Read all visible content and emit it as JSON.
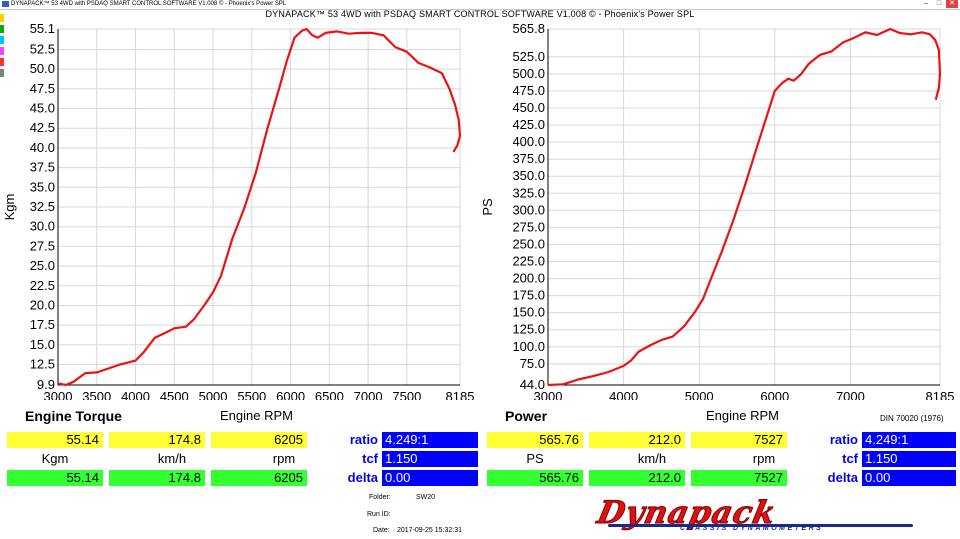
{
  "window": {
    "title": "DYNAPACK™ 53 4WD with PSDAQ SMART CONTROL SOFTWARE V1.008 © - Phoenix's Power SPL",
    "min_label": "–",
    "max_label": "□",
    "close_label": "✕",
    "icon": "app-icon"
  },
  "header": {
    "title": "DYNAPACK™ 53 4WD with PSDAQ SMART CONTROL SOFTWARE V1.008 © - Phoenix's Power SPL"
  },
  "swatch_colors": [
    "#ffd000",
    "#00b000",
    "#00c0ff",
    "#ff40ff",
    "#ff3030",
    "#808080"
  ],
  "chart_data": [
    {
      "type": "line",
      "title": "Engine Torque",
      "xlabel": "Engine RPM",
      "ylabel": "Kgm",
      "xlim": [
        3000,
        8185
      ],
      "ylim": [
        9.9,
        55.1
      ],
      "x_ticks": [
        "3000",
        "3500",
        "4000",
        "4500",
        "5000",
        "5500",
        "6000",
        "6500",
        "7000",
        "7500",
        "8185"
      ],
      "x_tick_values": [
        3000,
        3500,
        4000,
        4500,
        5000,
        5500,
        6000,
        6500,
        7000,
        7500,
        8185
      ],
      "y_ticks": [
        "9.9",
        "12.5",
        "15.0",
        "17.5",
        "20.0",
        "22.5",
        "25.0",
        "27.5",
        "30.0",
        "32.5",
        "35.0",
        "37.5",
        "40.0",
        "42.5",
        "45.0",
        "47.5",
        "50.0",
        "52.5",
        "55.1"
      ],
      "y_tick_values": [
        9.9,
        12.5,
        15,
        17.5,
        20,
        22.5,
        25,
        27.5,
        30,
        32.5,
        35,
        37.5,
        40,
        42.5,
        45,
        47.5,
        50,
        52.5,
        55.1
      ],
      "grid": true,
      "line_color": "#ee1111",
      "points": [
        [
          3000,
          10.1
        ],
        [
          3100,
          9.9
        ],
        [
          3200,
          10.3
        ],
        [
          3350,
          11.4
        ],
        [
          3500,
          11.5
        ],
        [
          3650,
          12.0
        ],
        [
          3800,
          12.5
        ],
        [
          4000,
          13.0
        ],
        [
          4100,
          14.0
        ],
        [
          4250,
          15.9
        ],
        [
          4400,
          16.6
        ],
        [
          4500,
          17.1
        ],
        [
          4650,
          17.3
        ],
        [
          4750,
          18.2
        ],
        [
          4900,
          20.2
        ],
        [
          5000,
          21.7
        ],
        [
          5100,
          23.7
        ],
        [
          5250,
          28.5
        ],
        [
          5400,
          32.3
        ],
        [
          5550,
          36.8
        ],
        [
          5700,
          42.4
        ],
        [
          5850,
          47.5
        ],
        [
          5950,
          51.0
        ],
        [
          6050,
          54.0
        ],
        [
          6150,
          54.9
        ],
        [
          6205,
          55.1
        ],
        [
          6280,
          54.3
        ],
        [
          6350,
          54.0
        ],
        [
          6450,
          54.6
        ],
        [
          6600,
          54.8
        ],
        [
          6750,
          54.5
        ],
        [
          6900,
          54.6
        ],
        [
          7050,
          54.6
        ],
        [
          7200,
          54.3
        ],
        [
          7350,
          52.8
        ],
        [
          7500,
          52.2
        ],
        [
          7650,
          50.8
        ],
        [
          7800,
          50.2
        ],
        [
          7950,
          49.5
        ],
        [
          8050,
          47.5
        ],
        [
          8120,
          45.5
        ],
        [
          8170,
          43.5
        ],
        [
          8185,
          41.5
        ],
        [
          8150,
          40.3
        ],
        [
          8100,
          39.5
        ]
      ]
    },
    {
      "type": "line",
      "title": "Power",
      "xlabel": "Engine RPM",
      "ylabel": "PS",
      "xlim": [
        3000,
        8185
      ],
      "ylim": [
        44.0,
        565.8
      ],
      "x_ticks": [
        "3000",
        "4000",
        "5000",
        "6000",
        "7000",
        "8185"
      ],
      "x_tick_values": [
        3000,
        4000,
        5000,
        6000,
        7000,
        8185
      ],
      "y_ticks": [
        "44.0",
        "75.0",
        "100.0",
        "125.0",
        "150.0",
        "175.0",
        "200.0",
        "225.0",
        "250.0",
        "275.0",
        "300.0",
        "325.0",
        "350.0",
        "375.0",
        "400.0",
        "425.0",
        "450.0",
        "475.0",
        "500.0",
        "525.0",
        "565.8"
      ],
      "y_tick_values": [
        44,
        75,
        100,
        125,
        150,
        175,
        200,
        225,
        250,
        275,
        300,
        325,
        350,
        375,
        400,
        425,
        450,
        475,
        500,
        525,
        565.8
      ],
      "grid": true,
      "line_color": "#ee1111",
      "points": [
        [
          3000,
          44
        ],
        [
          3200,
          45
        ],
        [
          3400,
          52
        ],
        [
          3600,
          57
        ],
        [
          3800,
          63
        ],
        [
          4000,
          72
        ],
        [
          4100,
          80
        ],
        [
          4200,
          93
        ],
        [
          4350,
          102
        ],
        [
          4500,
          110
        ],
        [
          4650,
          115
        ],
        [
          4800,
          130
        ],
        [
          4950,
          152
        ],
        [
          5050,
          170
        ],
        [
          5150,
          198
        ],
        [
          5300,
          240
        ],
        [
          5450,
          285
        ],
        [
          5600,
          335
        ],
        [
          5750,
          388
        ],
        [
          5900,
          440
        ],
        [
          6000,
          475
        ],
        [
          6100,
          487
        ],
        [
          6180,
          493
        ],
        [
          6250,
          490
        ],
        [
          6350,
          500
        ],
        [
          6450,
          515
        ],
        [
          6600,
          528
        ],
        [
          6750,
          533
        ],
        [
          6900,
          546
        ],
        [
          7050,
          553
        ],
        [
          7200,
          561
        ],
        [
          7350,
          557
        ],
        [
          7527,
          565.8
        ],
        [
          7650,
          560
        ],
        [
          7800,
          558
        ],
        [
          7950,
          561
        ],
        [
          8050,
          558
        ],
        [
          8120,
          550
        ],
        [
          8170,
          535
        ],
        [
          8185,
          500
        ],
        [
          8170,
          480
        ],
        [
          8130,
          462
        ]
      ]
    }
  ],
  "torque": {
    "section_label": "Engine Torque",
    "xlabel": "Engine RPM",
    "current": {
      "value": "55.14",
      "speed": "174.8",
      "rpm": "6205"
    },
    "units": {
      "value": "Kgm",
      "speed": "km/h",
      "rpm": "rpm"
    },
    "peak": {
      "value": "55.14",
      "speed": "174.8",
      "rpm": "6205"
    },
    "ratio_label": "ratio",
    "ratio": "4.249:1",
    "tcf_label": "tcf",
    "tcf": "1.150",
    "delta_label": "delta",
    "delta": "0.00"
  },
  "power": {
    "section_label": "Power",
    "xlabel": "Engine RPM",
    "standard": "DIN 70020 (1976)",
    "current": {
      "value": "565.76",
      "speed": "212.0",
      "rpm": "7527"
    },
    "units": {
      "value": "PS",
      "speed": "km/h",
      "rpm": "rpm"
    },
    "peak": {
      "value": "565.76",
      "speed": "212.0",
      "rpm": "7527"
    },
    "ratio_label": "ratio",
    "ratio": "4.249:1",
    "tcf_label": "tcf",
    "tcf": "1.150",
    "delta_label": "delta",
    "delta": "0.00"
  },
  "run_info": {
    "folder_label": "Folder:",
    "folder": "SW20",
    "run_id_label": "Run ID:",
    "run_id": "",
    "date_label": "Date:",
    "date": "2017-09-25 15:32:31"
  },
  "logo": {
    "wordmark": "Dynapack",
    "tagline": "CHASSIS DYNAMOMETERS",
    "colors": {
      "primary": "#dd1111",
      "secondary": "#1a2a88"
    }
  }
}
